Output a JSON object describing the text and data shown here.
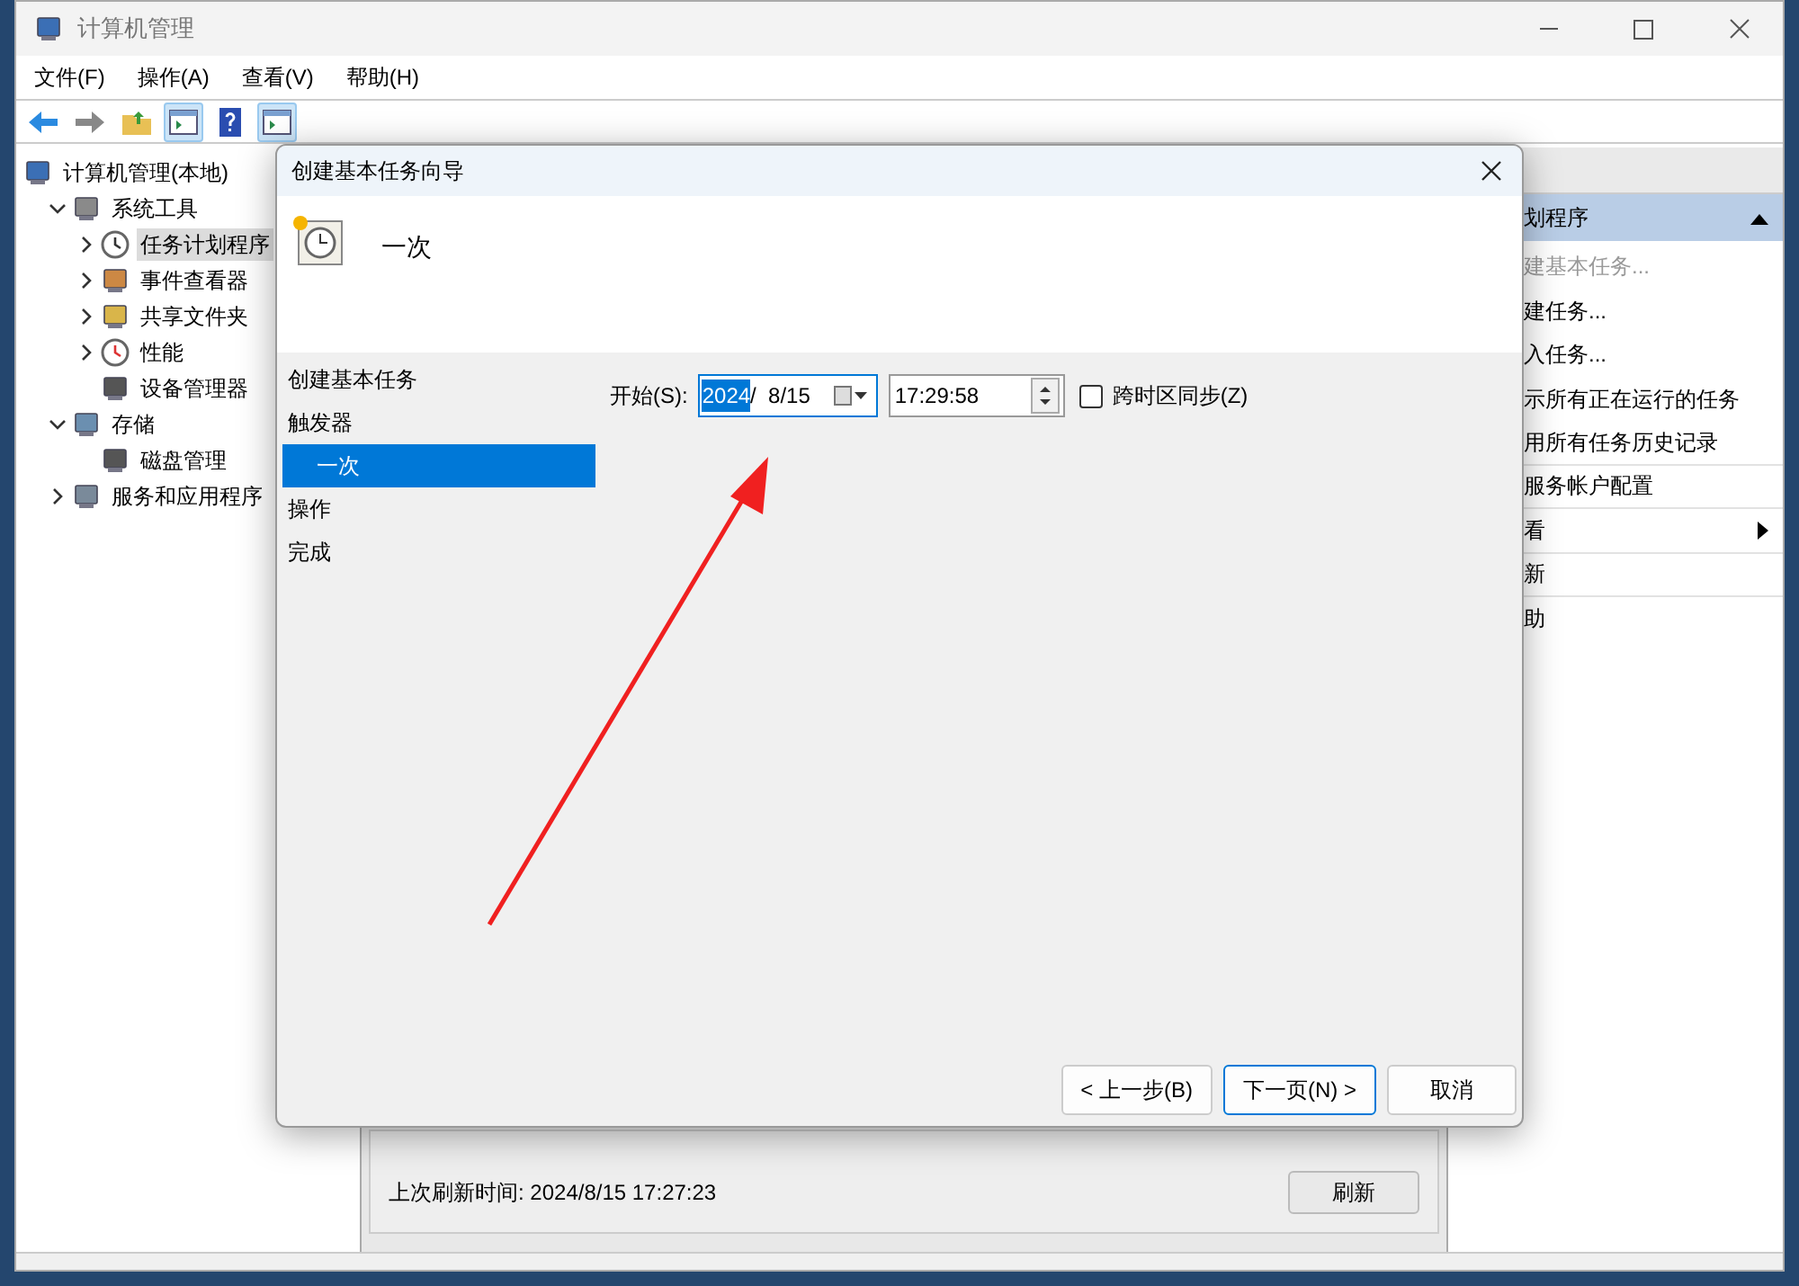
{
  "window": {
    "title": "计算机管理"
  },
  "menu": [
    "文件(F)",
    "操作(A)",
    "查看(V)",
    "帮助(H)"
  ],
  "toolbar": [
    {
      "pressed": false
    },
    {
      "pressed": false
    },
    {
      "pressed": false
    },
    {
      "pressed": true
    },
    {
      "pressed": false
    },
    {
      "pressed": true
    }
  ],
  "tree": [
    {
      "label": "计算机管理(本地)",
      "selected": false,
      "children": [
        {
          "label": "系统工具",
          "selected": false,
          "expanded": true,
          "children": [
            {
              "label": "任务计划程序",
              "selected": true,
              "expanded": false
            },
            {
              "label": "事件查看器",
              "selected": false,
              "expanded": false
            },
            {
              "label": "共享文件夹",
              "selected": false,
              "expanded": false
            },
            {
              "label": "性能",
              "selected": false,
              "expanded": false
            },
            {
              "label": "设备管理器",
              "selected": false
            }
          ]
        },
        {
          "label": "存储",
          "selected": false,
          "expanded": true,
          "children": [
            {
              "label": "磁盘管理",
              "selected": false
            }
          ]
        },
        {
          "label": "服务和应用程序",
          "selected": false,
          "expanded": false
        }
      ]
    }
  ],
  "center": {
    "refresh_text": "上次刷新时间: 2024/8/15 17:27:23",
    "refresh_button": "刷新"
  },
  "actions": {
    "header": "划程序",
    "items": [
      {
        "label": "建基本任务...",
        "disabled": true,
        "submenu": false,
        "separator": false
      },
      {
        "label": "建任务...",
        "disabled": false,
        "submenu": false,
        "separator": false
      },
      {
        "label": "入任务...",
        "disabled": false,
        "submenu": false,
        "separator": false
      },
      {
        "label": "示所有正在运行的任务",
        "disabled": false,
        "submenu": false,
        "separator": false
      },
      {
        "label": "用所有任务历史记录",
        "disabled": false,
        "submenu": false,
        "separator": true
      },
      {
        "label": "服务帐户配置",
        "disabled": false,
        "submenu": false,
        "separator": true
      },
      {
        "label": "看",
        "disabled": false,
        "submenu": true,
        "separator": true
      },
      {
        "label": "新",
        "disabled": false,
        "submenu": false,
        "separator": true
      },
      {
        "label": "助",
        "disabled": false,
        "submenu": false,
        "separator": false
      }
    ]
  },
  "dialog": {
    "title": "创建基本任务向导",
    "heading": "一次",
    "steps": [
      {
        "label": "创建基本任务",
        "selected": false
      },
      {
        "label": "触发器",
        "selected": false,
        "children": [
          {
            "label": "一次",
            "selected": true
          }
        ]
      },
      {
        "label": "操作",
        "selected": false
      },
      {
        "label": "完成",
        "selected": false
      }
    ],
    "start_label": "开始(S):",
    "date_year": "2024",
    "date_rest": "/  8/15",
    "time": "17:29:58",
    "sync": {
      "label": "跨时区同步(Z)",
      "checked": false
    },
    "buttons": [
      {
        "label": "< 上一步(B)",
        "default": false
      },
      {
        "label": "下一页(N) >",
        "default": true
      },
      {
        "label": "取消",
        "default": false
      }
    ]
  }
}
